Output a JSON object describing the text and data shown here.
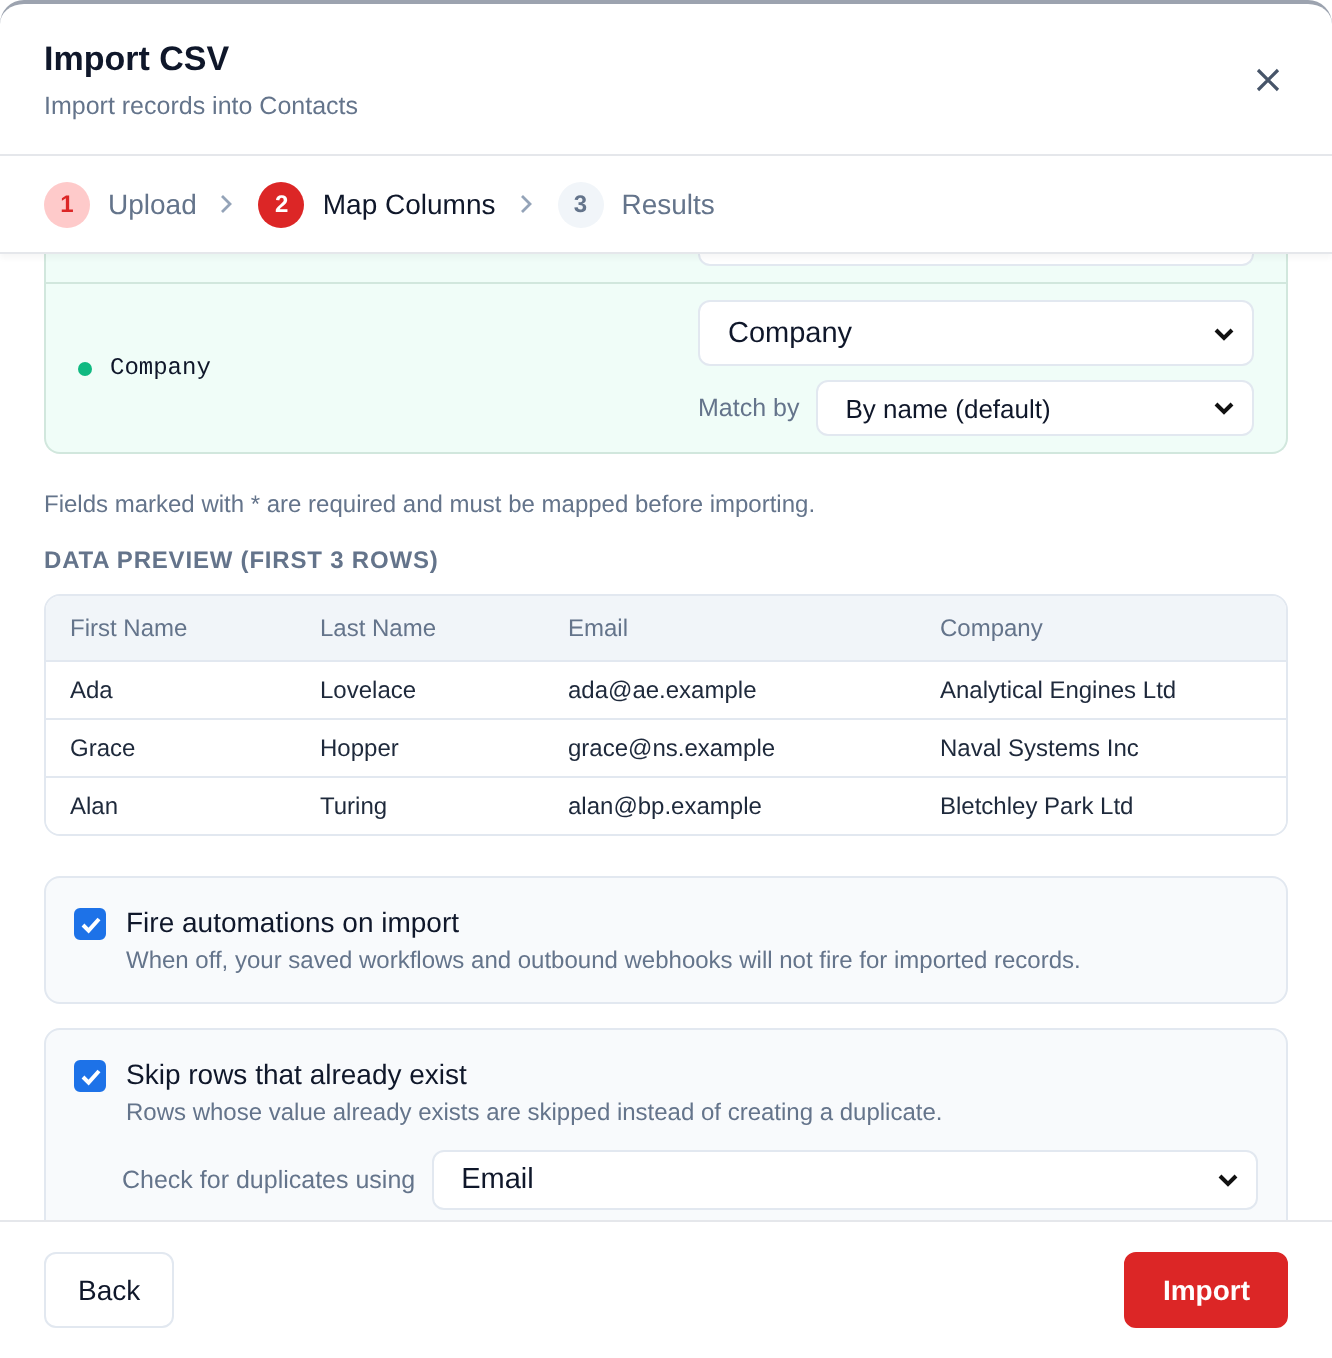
{
  "dialog": {
    "title": "Import CSV",
    "subtitle": "Import records into Contacts"
  },
  "steps": [
    {
      "number": "1",
      "label": "Upload",
      "completed": true,
      "selected": false
    },
    {
      "number": "2",
      "label": "Map Columns",
      "completed": false,
      "selected": true
    },
    {
      "number": "3",
      "label": "Results",
      "completed": false,
      "selected": false
    }
  ],
  "mappings": [
    {
      "source": "Company",
      "mapped": true,
      "target": "Company",
      "match_label": "Match by",
      "match_value": "By name (default)"
    }
  ],
  "required_note": "Fields marked with * are required and must be mapped before importing.",
  "preview": {
    "title": "DATA PREVIEW (FIRST 3 ROWS)",
    "columns": [
      "First Name",
      "Last Name",
      "Email",
      "Company"
    ],
    "rows": [
      [
        "Ada",
        "Lovelace",
        "ada@ae.example",
        "Analytical Engines Ltd"
      ],
      [
        "Grace",
        "Hopper",
        "grace@ns.example",
        "Naval Systems Inc"
      ],
      [
        "Alan",
        "Turing",
        "alan@bp.example",
        "Bletchley Park Ltd"
      ]
    ]
  },
  "options": [
    {
      "label": "Fire automations on import",
      "description": "When off, your saved workflows and outbound webhooks will not fire for imported records.",
      "checked": true
    },
    {
      "label": "Skip rows that already exist",
      "description": "Rows whose value already exists are skipped instead of creating a duplicate.",
      "checked": true,
      "field_label": "Check for duplicates using",
      "field_value": "Email"
    }
  ],
  "footer": {
    "back": "Back",
    "import": "Import"
  }
}
